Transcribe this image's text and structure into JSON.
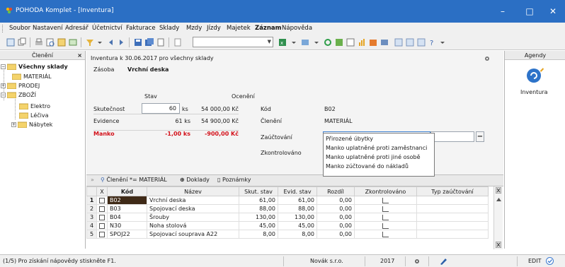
{
  "window": {
    "title": "POHODA Komplet - [Inventura]",
    "title_bar_color": "#2b6fc4",
    "controls": [
      "–",
      "□",
      "✕"
    ]
  },
  "menu": {
    "items": [
      {
        "label": "Soubor",
        "bold": false
      },
      {
        "label": "Nastavení",
        "bold": false
      },
      {
        "label": "Adresář",
        "bold": false
      },
      {
        "label": "Účetnictví",
        "bold": false
      },
      {
        "label": "Fakturace",
        "bold": false
      },
      {
        "label": "Sklady",
        "bold": false
      },
      {
        "label": "Mzdy",
        "bold": false
      },
      {
        "label": "Jízdy",
        "bold": false
      },
      {
        "label": "Majetek",
        "bold": false
      },
      {
        "label": "Záznam",
        "bold": true
      },
      {
        "label": "Nápověda",
        "bold": false
      }
    ]
  },
  "left_panel": {
    "header": "Členění",
    "close": "×",
    "tree": {
      "root": "Všechny sklady",
      "material": "MATERIÁL",
      "prodej": "PRODEJ",
      "zbozi": "ZBOŽÍ",
      "elektro": "Elektro",
      "leciva": "Léčiva",
      "nabytek": "Nábytek"
    }
  },
  "form": {
    "header": "Inventura k 30.06.2017 pro všechny sklady",
    "zasoba_label": "Zásoba",
    "zasoba_value": "Vrchní deska",
    "col_stav": "Stav",
    "col_oceneni": "Ocenění",
    "skutecnost_label": "Skutečnost",
    "skutecnost_value": "60",
    "skutecnost_unit": "ks",
    "skutecnost_cost": "54 000,00 Kč",
    "evidence_label": "Evidence",
    "evidence_value": "61 ks",
    "evidence_cost": "54 900,00 Kč",
    "manko_label": "Manko",
    "manko_value": "-1,00 ks",
    "manko_cost": "-900,00 Kč",
    "kod_label": "Kód",
    "kod_value": "B02",
    "cleneni_label": "Členění",
    "cleneni_value": "MATERIÁL",
    "zauctovani_label": "Zaúčtování",
    "zkontrolovano_label": "Zkontrolováno",
    "manko_color": "#d3111a"
  },
  "dropdown": {
    "options": [
      "Přirozené úbytky",
      "Manko uplatněné proti zaměstnanci",
      "Manko uplatněné proti jiné osobě",
      "Manko zúčtované do nákladů"
    ]
  },
  "grid_tabs": {
    "filter": "Členění *= MATERIÁL",
    "doklady": "Doklady",
    "poznamky": "Poznámky"
  },
  "grid": {
    "columns": [
      "",
      "X",
      "Kód",
      "Název",
      "Skut. stav",
      "Evid. stav",
      "Rozdíl",
      "Zkontrolováno",
      "Typ zaúčtování"
    ],
    "rows": [
      {
        "n": "1",
        "kod": "B02",
        "nazev": "Vrchní deska",
        "skut": "61,00",
        "evid": "61,00",
        "rozdil": "0,00"
      },
      {
        "n": "2",
        "kod": "B03",
        "nazev": "Spojovací deska",
        "skut": "88,00",
        "evid": "88,00",
        "rozdil": "0,00"
      },
      {
        "n": "3",
        "kod": "B04",
        "nazev": "Šrouby",
        "skut": "130,00",
        "evid": "130,00",
        "rozdil": "0,00"
      },
      {
        "n": "4",
        "kod": "N30",
        "nazev": "Noha stolová",
        "skut": "45,00",
        "evid": "45,00",
        "rozdil": "0,00"
      },
      {
        "n": "5",
        "kod": "SPOJ22",
        "nazev": "Spojovací souprava A22",
        "skut": "8,00",
        "evid": "8,00",
        "rozdil": "0,00"
      }
    ]
  },
  "right_panel": {
    "header": "Agendy",
    "item": "Inventura"
  },
  "status": {
    "hint": "(1/5) Pro získání nápovědy stiskněte F1.",
    "company": "Novák s.r.o.",
    "year": "2017",
    "mode": "EDIT"
  }
}
